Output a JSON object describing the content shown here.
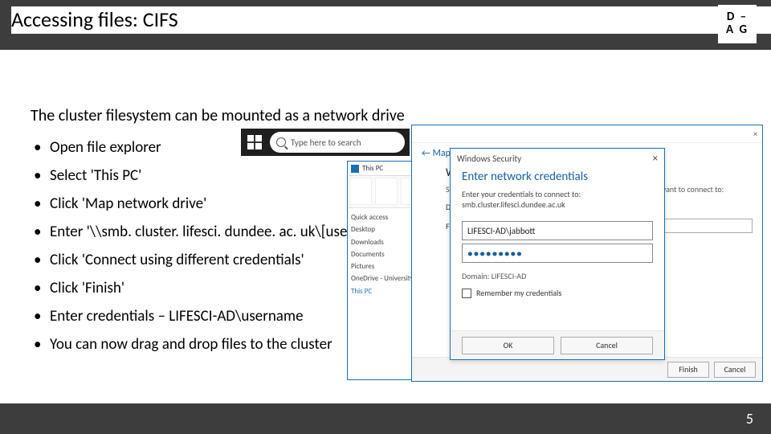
{
  "header": {
    "title": "Accessing files: CIFS",
    "logo_top": "D –",
    "logo_bottom": "A G"
  },
  "intro": "The cluster filesystem can be mounted as a network drive",
  "bullets": [
    "Open file explorer",
    "Select 'This PC'",
    "Click 'Map network drive'",
    "Enter '\\\\smb. cluster. lifesci. dundee. ac. uk\\[username]'",
    "Click 'Connect using different credentials'",
    "Click 'Finish'",
    "Enter credentials – LIFESCI-AD\\username",
    "You can now drag and drop files to the cluster"
  ],
  "taskbar": {
    "search_placeholder": "Type here to search"
  },
  "explorer": {
    "title": "This PC",
    "side": [
      "Quick access",
      "Desktop",
      "Downloads",
      "Documents",
      "Pictures",
      "OneDrive - University",
      "This PC"
    ]
  },
  "mapdrive": {
    "breadcrumb": "←  Map Network Drive",
    "close": "×",
    "question": "What network folder would you like to map?",
    "sub": "Specify the drive letter for the connection and the folder that you want to connect to:",
    "drive_label": "Drive:",
    "folder_label": "Folder:",
    "finish": "Finish",
    "cancel": "Cancel"
  },
  "cred": {
    "window_title": "Windows Security",
    "close": "×",
    "heading": "Enter network credentials",
    "sub": "Enter your credentials to connect to: smb.cluster.lifesci.dundee.ac.uk",
    "user_value": "LIFESCI-AD\\jabbott",
    "pw_value": "●●●●●●●●●",
    "domain": "Domain: LIFESCI-AD",
    "remember": "Remember my credentials",
    "ok": "OK",
    "cancel": "Cancel"
  },
  "footer": {
    "page": "5"
  }
}
